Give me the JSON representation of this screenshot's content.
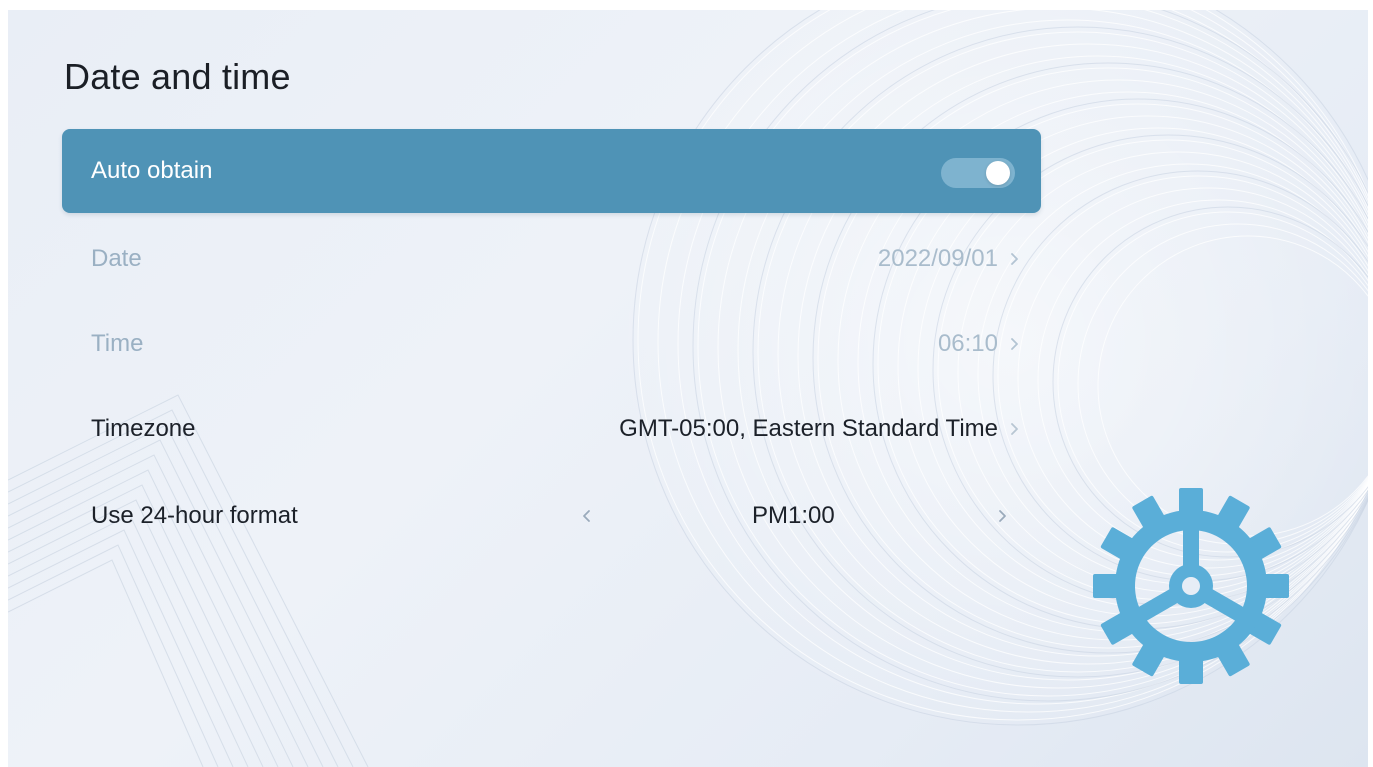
{
  "page": {
    "title": "Date and time"
  },
  "settings": {
    "auto_obtain": {
      "label": "Auto obtain",
      "enabled": true
    },
    "date": {
      "label": "Date",
      "value": "2022/09/01"
    },
    "time": {
      "label": "Time",
      "value": "06:10"
    },
    "timezone": {
      "label": "Timezone",
      "value": "GMT-05:00, Eastern Standard Time"
    },
    "hour_format": {
      "label": "Use 24-hour format",
      "value": "PM1:00"
    }
  },
  "icons": {
    "chevron": "chevron-right-icon",
    "stepper_prev": "chevron-left-icon",
    "decoration": "gear-icon"
  },
  "colors": {
    "selected_row": "#4f93b6",
    "toggle_track": "#7eb3cf",
    "gear": "#5aaed8",
    "disabled_text": "#9ab0c3"
  }
}
